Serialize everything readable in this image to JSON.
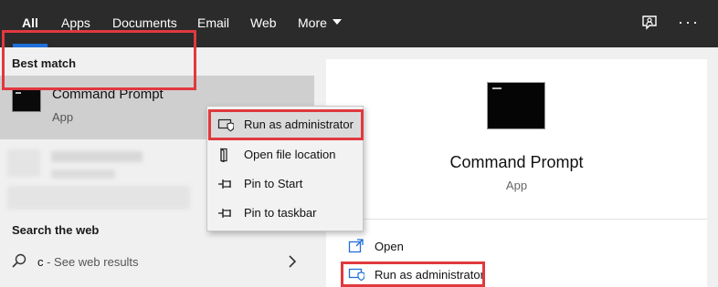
{
  "nav": {
    "tabs": [
      {
        "label": "All",
        "active": true
      },
      {
        "label": "Apps"
      },
      {
        "label": "Documents"
      },
      {
        "label": "Email"
      },
      {
        "label": "Web"
      },
      {
        "label": "More"
      }
    ],
    "more_icon": "caret-down-icon",
    "right_icons": [
      "feedback-icon",
      "ellipsis-icon"
    ]
  },
  "best_match": {
    "heading": "Best match",
    "title": "Command Prompt",
    "subtitle": "App",
    "icon": "command-prompt-icon"
  },
  "search_web": {
    "heading": "Search the web",
    "query": "c",
    "suffix": " - See web results"
  },
  "context_menu": {
    "items": [
      {
        "label": "Run as administrator",
        "icon": "shield-icon"
      },
      {
        "label": "Open file location",
        "icon": "folder-icon"
      },
      {
        "label": "Pin to Start",
        "icon": "pin-icon"
      },
      {
        "label": "Pin to taskbar",
        "icon": "pin-icon"
      }
    ]
  },
  "detail": {
    "title": "Command Prompt",
    "subtitle": "App",
    "actions": [
      {
        "label": "Open",
        "icon": "open-icon"
      },
      {
        "label": "Run as administrator",
        "icon": "shield-icon"
      }
    ]
  },
  "colors": {
    "topbar": "#2b2b2b",
    "accent": "#1e6fd9",
    "highlight_border": "#e0393e",
    "action_icon": "#1e6fd9"
  }
}
